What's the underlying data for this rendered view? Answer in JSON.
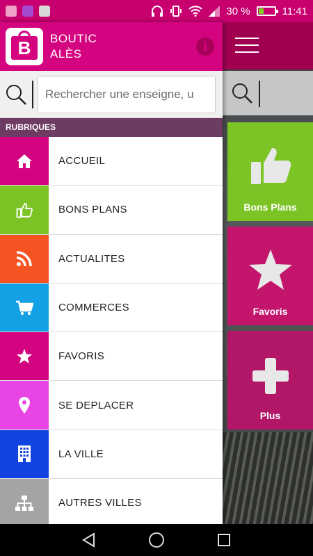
{
  "status_bar": {
    "battery_text": "30 %",
    "battery_level": 0.3,
    "time": "11:41"
  },
  "drawer": {
    "app_name_line1": "BOUTIC",
    "app_name_line2": "ALÈS",
    "logo_letter": "B",
    "info_glyph": "i",
    "search": {
      "placeholder": "Rechercher une enseigne, u"
    },
    "section_title": "RUBRIQUES",
    "items": [
      {
        "label": "ACCUEIL",
        "icon": "home-icon",
        "color": "#d4037f"
      },
      {
        "label": "BONS PLANS",
        "icon": "thumbs-up-icon",
        "color": "#7cc425"
      },
      {
        "label": "ACTUALITES",
        "icon": "rss-icon",
        "color": "#f55322"
      },
      {
        "label": "COMMERCES",
        "icon": "cart-icon",
        "color": "#13a0e4"
      },
      {
        "label": "FAVORIS",
        "icon": "star-icon",
        "color": "#d4037f"
      },
      {
        "label": "SE DEPLACER",
        "icon": "location-pin-icon",
        "color": "#e945e6"
      },
      {
        "label": "LA VILLE",
        "icon": "building-icon",
        "color": "#1043e0"
      },
      {
        "label": "AUTRES VILLES",
        "icon": "sitemap-icon",
        "color": "#a4a4a4"
      }
    ]
  },
  "background": {
    "tiles": [
      {
        "label": "Bons Plans",
        "icon": "thumbs-up-icon"
      },
      {
        "label": "Favoris",
        "icon": "star-icon"
      },
      {
        "label": "Plus",
        "icon": "plus-icon"
      }
    ]
  },
  "colors": {
    "brand_pink": "#d4037f",
    "section_bar": "#6e3b63"
  }
}
